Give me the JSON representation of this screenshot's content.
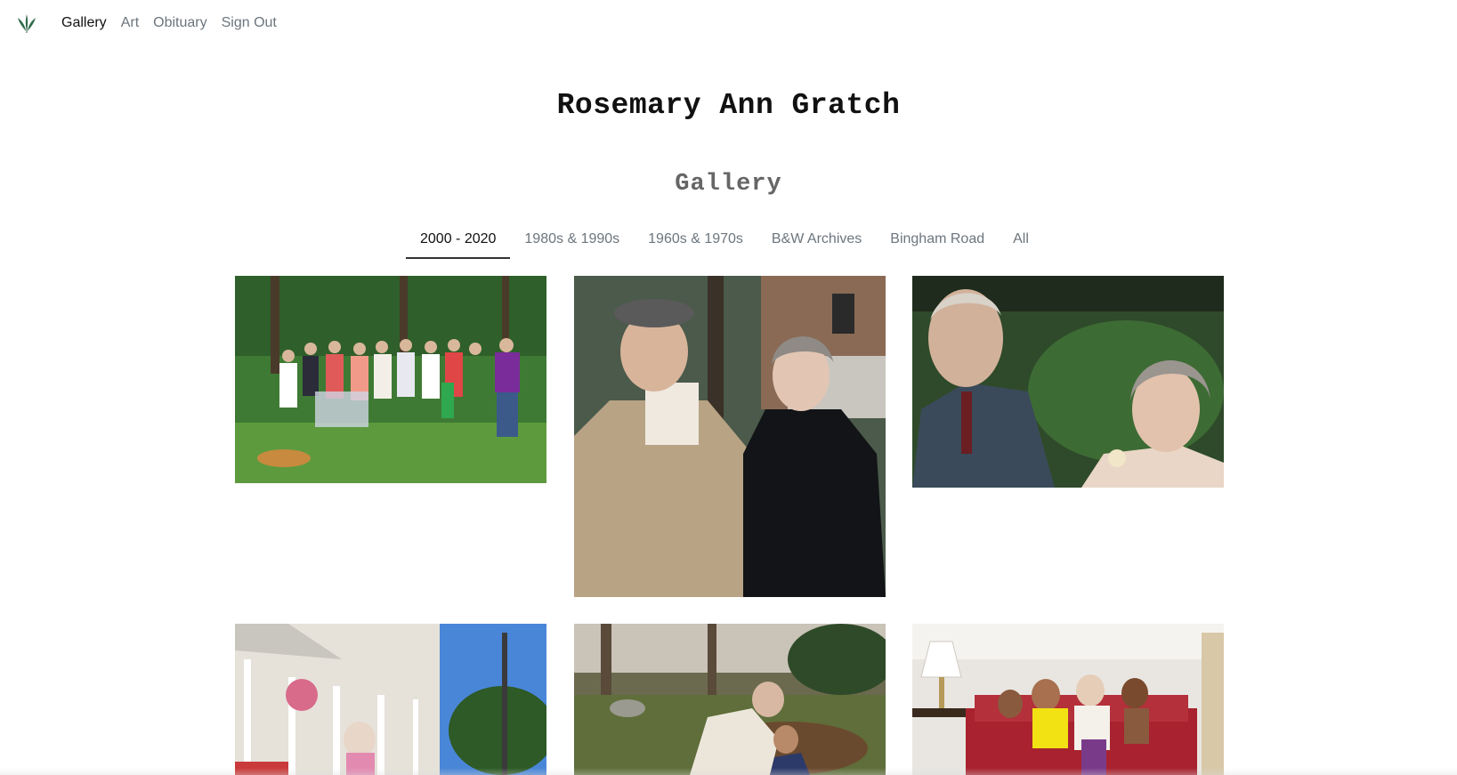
{
  "nav": {
    "logo_icon": "leaf-logo-icon",
    "items": [
      {
        "label": "Gallery",
        "active": true
      },
      {
        "label": "Art",
        "active": false
      },
      {
        "label": "Obituary",
        "active": false
      },
      {
        "label": "Sign Out",
        "active": false
      }
    ]
  },
  "page": {
    "title": "Rosemary Ann Gratch",
    "section_heading": "Gallery"
  },
  "tabs": [
    {
      "label": "2000 - 2020",
      "active": true
    },
    {
      "label": "1980s & 1990s",
      "active": false
    },
    {
      "label": "1960s & 1970s",
      "active": false
    },
    {
      "label": "B&W Archives",
      "active": false
    },
    {
      "label": "Bingham Road",
      "active": false
    },
    {
      "label": "All",
      "active": false
    }
  ],
  "colors": {
    "logo_green": "#2e6b4a",
    "active_text": "#111111",
    "muted_text": "#6c757d"
  }
}
